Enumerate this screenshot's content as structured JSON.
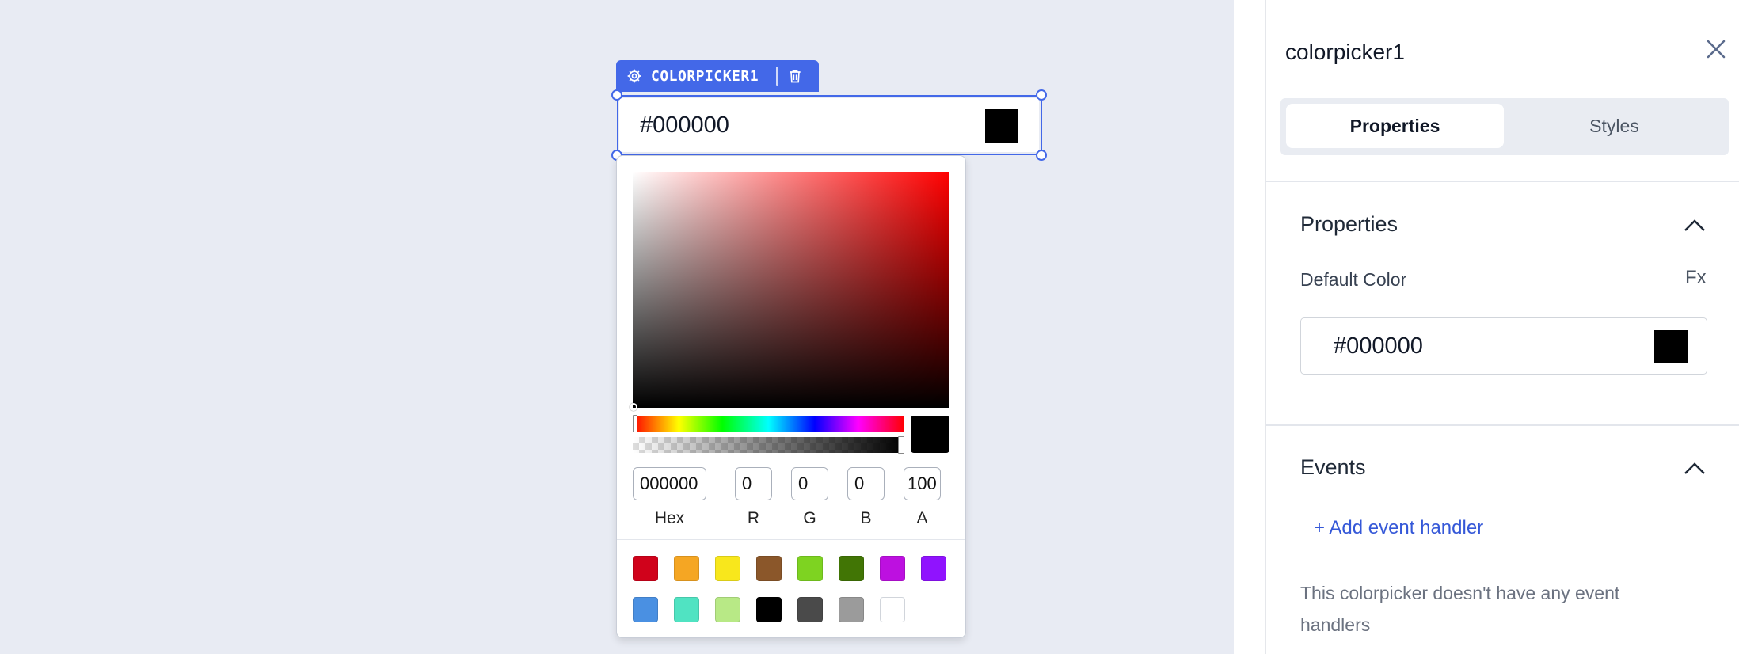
{
  "widget": {
    "tag_label": "COLORPICKER1",
    "input_value": "#000000",
    "swatch_color": "#000000"
  },
  "picker": {
    "hue": "#ff0000",
    "fields": {
      "hex": "000000",
      "r": "0",
      "g": "0",
      "b": "0",
      "a": "100"
    },
    "labels": {
      "hex": "Hex",
      "r": "R",
      "g": "G",
      "b": "B",
      "a": "A"
    },
    "swatches": [
      "#d0021b",
      "#f5a623",
      "#f8e71c",
      "#8b572a",
      "#7ed321",
      "#417505",
      "#bd10e0",
      "#9013fe",
      "#4a90e2",
      "#50e3c2",
      "#b8e986",
      "#000000",
      "#4a4a4a",
      "#9b9b9b",
      "#ffffff"
    ]
  },
  "panel": {
    "title": "colorpicker1",
    "tabs": {
      "properties": "Properties",
      "styles": "Styles"
    },
    "properties_section": {
      "title": "Properties",
      "default_color_label": "Default Color",
      "fx_label": "Fx",
      "default_color_value": "#000000"
    },
    "events_section": {
      "title": "Events",
      "add_handler": "+ Add event handler",
      "empty_message": "This colorpicker doesn't have any event handlers"
    }
  },
  "colors": {
    "accent": "#4368e8",
    "canvas": "#e8ebf3",
    "link": "#3558d8"
  }
}
